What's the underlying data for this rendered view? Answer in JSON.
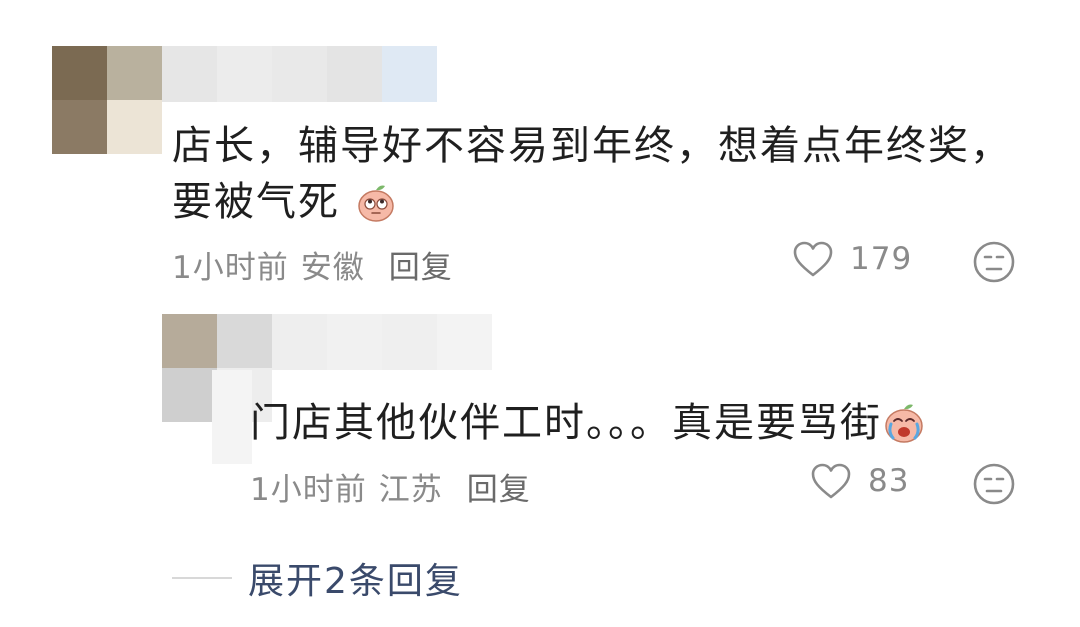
{
  "comments": [
    {
      "text": "店长，辅导好不容易到年终，想着点年终奖，要被气死",
      "time": "1小时前",
      "location": "安徽",
      "reply_label": "回复",
      "likes": "179",
      "emoji": "peach-rolling-eyes-emoji"
    },
    {
      "text": "门店其他伙伴工时。。。真是要骂街",
      "time": "1小时前",
      "location": "江苏",
      "reply_label": "回复",
      "likes": "83",
      "emoji": "peach-crying-emoji"
    }
  ],
  "expand_replies": {
    "label": "展开2条回复"
  },
  "colors": {
    "text": "#1f1f1f",
    "meta": "#8a8a8a",
    "link": "#3a4a6b"
  }
}
